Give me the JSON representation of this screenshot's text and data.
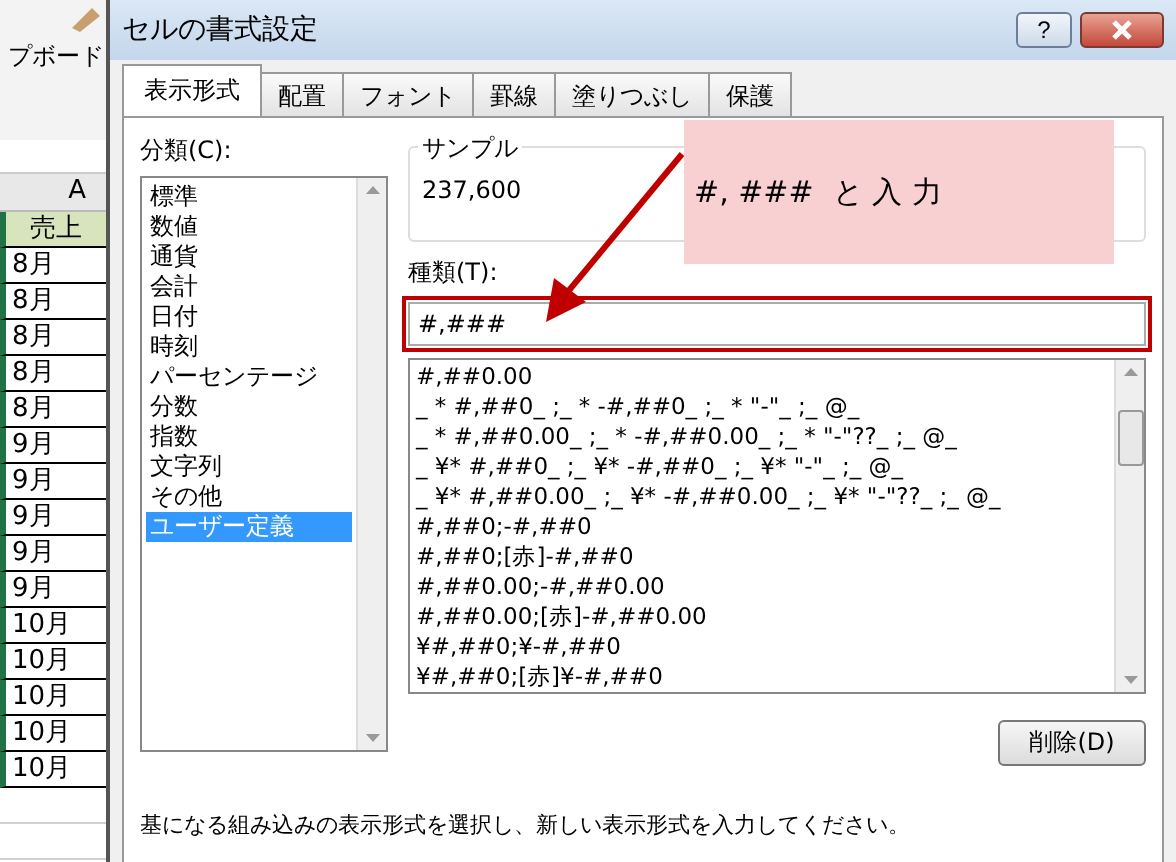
{
  "spreadsheet": {
    "ribbon_label": "プボード",
    "column_header": "A",
    "cells": [
      {
        "text": "売上",
        "kind": "header"
      },
      {
        "text": "8月",
        "kind": "data"
      },
      {
        "text": "8月",
        "kind": "data"
      },
      {
        "text": "8月",
        "kind": "data"
      },
      {
        "text": "8月",
        "kind": "data"
      },
      {
        "text": "8月",
        "kind": "data"
      },
      {
        "text": "9月",
        "kind": "data"
      },
      {
        "text": "9月",
        "kind": "data"
      },
      {
        "text": "9月",
        "kind": "data"
      },
      {
        "text": "9月",
        "kind": "data"
      },
      {
        "text": "9月",
        "kind": "data"
      },
      {
        "text": "10月",
        "kind": "data"
      },
      {
        "text": "10月",
        "kind": "data"
      },
      {
        "text": "10月",
        "kind": "data"
      },
      {
        "text": "10月",
        "kind": "data"
      },
      {
        "text": "10月",
        "kind": "data"
      }
    ]
  },
  "dialog": {
    "title": "セルの書式設定",
    "help_button": "?",
    "tabs": [
      {
        "label": "表示形式",
        "selected": true
      },
      {
        "label": "配置",
        "selected": false
      },
      {
        "label": "フォント",
        "selected": false
      },
      {
        "label": "罫線",
        "selected": false
      },
      {
        "label": "塗りつぶし",
        "selected": false
      },
      {
        "label": "保護",
        "selected": false
      }
    ],
    "category_label": "分類(C):",
    "categories": [
      {
        "label": "標準",
        "selected": false
      },
      {
        "label": "数値",
        "selected": false
      },
      {
        "label": "通貨",
        "selected": false
      },
      {
        "label": "会計",
        "selected": false
      },
      {
        "label": "日付",
        "selected": false
      },
      {
        "label": "時刻",
        "selected": false
      },
      {
        "label": "パーセンテージ",
        "selected": false
      },
      {
        "label": "分数",
        "selected": false
      },
      {
        "label": "指数",
        "selected": false
      },
      {
        "label": "文字列",
        "selected": false
      },
      {
        "label": "その他",
        "selected": false
      },
      {
        "label": "ユーザー定義",
        "selected": true
      }
    ],
    "sample_label": "サンプル",
    "sample_value": "237,600",
    "type_label": "種類(T):",
    "type_value": "#,###",
    "formats": [
      "#,##0.00",
      "_ * #,##0_ ;_ * -#,##0_ ;_ * \"-\"_ ;_ @_",
      "_ * #,##0.00_ ;_ * -#,##0.00_ ;_ * \"-\"??_ ;_ @_",
      "_ ¥* #,##0_ ;_ ¥* -#,##0_ ;_ ¥* \"-\"_ ;_ @_",
      "_ ¥* #,##0.00_ ;_ ¥* -#,##0.00_ ;_ ¥* \"-\"??_ ;_ @_",
      "#,##0;-#,##0",
      "#,##0;[赤]-#,##0",
      "#,##0.00;-#,##0.00",
      "#,##0.00;[赤]-#,##0.00",
      "¥#,##0;¥-#,##0",
      "¥#,##0;[赤]¥-#,##0"
    ],
    "delete_button": "削除(D)",
    "hint": "基になる組み込みの表示形式を選択し、新しい表示形式を入力してください。",
    "callout": "#, ###  と 入 力"
  }
}
